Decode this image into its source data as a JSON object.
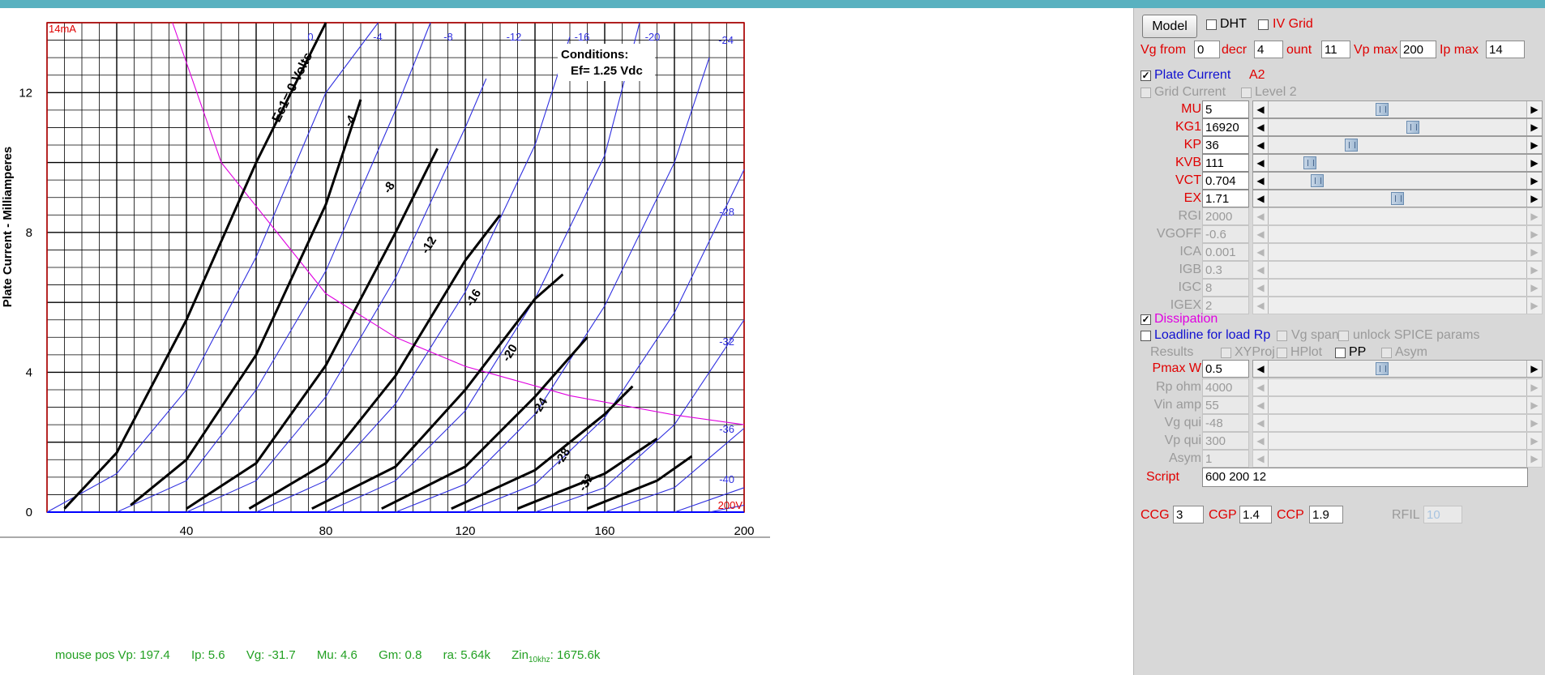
{
  "chart_data": {
    "type": "line",
    "title": "",
    "ylabel": "Plate Current - Milliamperes",
    "xlabel": "",
    "xlim": [
      0,
      200
    ],
    "ylim": [
      0,
      14
    ],
    "x_ticks": [
      "40",
      "80",
      "120",
      "160",
      "200"
    ],
    "y_ticks": [
      "0",
      "4",
      "8",
      "12"
    ],
    "y_top_label": "14mA",
    "x_end_label": "200V",
    "conditions_title": "Conditions:",
    "conditions_value": "Ef= 1.25 Vdc",
    "ec1_label": "Ec1= 0 Volts",
    "curve_labels": [
      "-4",
      "-8",
      "-12",
      "-16",
      "-20",
      "-24",
      "-28",
      "-32"
    ],
    "model_grid_labels": [
      "0",
      "-4",
      "-8",
      "-12",
      "-16",
      "-20",
      "-24",
      "-28",
      "-32",
      "-36",
      "-40"
    ],
    "grid": true,
    "series": [
      {
        "name": "0",
        "color": "#000000",
        "x": [
          5,
          20,
          40,
          60,
          80
        ],
        "y": [
          0.1,
          1.7,
          5.5,
          10.0,
          14.0
        ]
      },
      {
        "name": "-4",
        "color": "#000000",
        "x": [
          24,
          40,
          60,
          80,
          90
        ],
        "y": [
          0.2,
          1.5,
          4.5,
          8.8,
          11.8
        ]
      },
      {
        "name": "-8",
        "color": "#000000",
        "x": [
          40,
          60,
          80,
          100,
          112
        ],
        "y": [
          0.1,
          1.4,
          4.2,
          8.0,
          10.4
        ]
      },
      {
        "name": "-12",
        "color": "#000000",
        "x": [
          58,
          80,
          100,
          120,
          130
        ],
        "y": [
          0.1,
          1.4,
          3.9,
          7.2,
          8.5
        ]
      },
      {
        "name": "-16",
        "color": "#000000",
        "x": [
          76,
          100,
          120,
          140,
          148
        ],
        "y": [
          0.1,
          1.3,
          3.5,
          6.1,
          6.8
        ]
      },
      {
        "name": "-20",
        "color": "#000000",
        "x": [
          96,
          120,
          140,
          155
        ],
        "y": [
          0.1,
          1.3,
          3.3,
          5.0
        ]
      },
      {
        "name": "-24",
        "color": "#000000",
        "x": [
          116,
          140,
          160,
          168
        ],
        "y": [
          0.1,
          1.2,
          2.8,
          3.6
        ]
      },
      {
        "name": "-28",
        "color": "#000000",
        "x": [
          135,
          160,
          175
        ],
        "y": [
          0.1,
          1.1,
          2.1
        ]
      },
      {
        "name": "-32",
        "color": "#000000",
        "x": [
          155,
          175,
          185
        ],
        "y": [
          0.1,
          0.9,
          1.6
        ]
      }
    ],
    "model_series": [
      {
        "name": "0",
        "x": [
          0,
          20,
          40,
          60,
          80,
          95
        ],
        "y": [
          0,
          1.1,
          3.5,
          7.3,
          12.0,
          14.0
        ]
      },
      {
        "name": "-4",
        "x": [
          20,
          40,
          60,
          80,
          100,
          110
        ],
        "y": [
          0,
          0.9,
          3.5,
          6.9,
          11.5,
          14.0
        ]
      },
      {
        "name": "-8",
        "x": [
          40,
          60,
          80,
          100,
          120,
          126
        ],
        "y": [
          0,
          0.9,
          3.3,
          6.7,
          11.0,
          12.4
        ]
      },
      {
        "name": "-12",
        "x": [
          60,
          80,
          100,
          120,
          140,
          150
        ],
        "y": [
          0,
          0.9,
          3.1,
          6.3,
          10.5,
          13.6
        ]
      },
      {
        "name": "-16",
        "x": [
          80,
          100,
          120,
          140,
          160,
          170
        ],
        "y": [
          0,
          0.9,
          2.9,
          6.1,
          10.2,
          14.0
        ]
      },
      {
        "name": "-20",
        "x": [
          100,
          120,
          140,
          160,
          180,
          190
        ],
        "y": [
          0,
          0.8,
          2.8,
          5.9,
          10.0,
          13.0
        ]
      },
      {
        "name": "-24",
        "x": [
          120,
          140,
          160,
          180,
          200
        ],
        "y": [
          0,
          0.8,
          2.7,
          5.7,
          9.8
        ]
      },
      {
        "name": "-28",
        "x": [
          140,
          160,
          180,
          200
        ],
        "y": [
          0,
          0.7,
          2.5,
          5.5
        ]
      },
      {
        "name": "-32",
        "x": [
          160,
          180,
          200
        ],
        "y": [
          0,
          0.7,
          2.4
        ]
      },
      {
        "name": "-36",
        "x": [
          180,
          200
        ],
        "y": [
          0,
          0.7
        ]
      },
      {
        "name": "-40",
        "x": [
          190,
          200
        ],
        "y": [
          0,
          0.2
        ]
      }
    ],
    "dissipation": {
      "x": [
        36,
        50,
        80,
        100,
        120,
        150,
        180,
        200
      ],
      "y": [
        14.0,
        10.0,
        6.25,
        5.0,
        4.17,
        3.33,
        2.78,
        2.5
      ]
    }
  },
  "status_bar": {
    "vp": "mouse pos Vp: 197.4",
    "ip": "Ip: 5.6",
    "vg": "Vg: -31.7",
    "mu": "Mu: 4.6",
    "gm": "Gm: 0.8",
    "ra": "ra: 5.64k",
    "zin_label": "Zin",
    "zin_sub": "10khz",
    "zin_value": ": 1675.6k"
  },
  "panel": {
    "model_button": "Model",
    "dht_label": "DHT",
    "ivgrid_label": "IV Grid",
    "vg_from_label": "Vg from",
    "vg_from_value": "0",
    "decr_label": "decr",
    "decr_value": "4",
    "count_label": "ount",
    "count_value": "11",
    "vp_max_label": "Vp max",
    "vp_max_value": "200",
    "ip_max_label": "Ip max",
    "ip_max_value": "14",
    "plate_current_label": "Plate Current",
    "a2_label": "A2",
    "grid_current_label": "Grid Current",
    "level2_label": "Level 2",
    "params": [
      {
        "label": "MU",
        "value": "5",
        "level": 0.44
      },
      {
        "label": "KG1",
        "value": "16920",
        "level": 0.56
      },
      {
        "label": "KP",
        "value": "36",
        "level": 0.32
      },
      {
        "label": "KVB",
        "value": "111",
        "level": 0.16
      },
      {
        "label": "VCT",
        "value": "0.704",
        "level": 0.19
      },
      {
        "label": "EX",
        "value": "1.71",
        "level": 0.5
      }
    ],
    "disabled_params": [
      {
        "label": "RGI",
        "value": "2000"
      },
      {
        "label": "VGOFF",
        "value": "-0.6"
      },
      {
        "label": "ICA",
        "value": "0.001"
      },
      {
        "label": "IGB",
        "value": "0.3"
      },
      {
        "label": "IGC",
        "value": "8"
      },
      {
        "label": "IGEX",
        "value": "2"
      }
    ],
    "dissipation_label": "Dissipation",
    "loadline_label": "Loadline for load Rp",
    "vg_span_label": "Vg span",
    "unlock_label": "unlock SPICE params",
    "results_label": "Results",
    "xyproj_label": "XYProj",
    "hplot_label": "HPlot",
    "pp_label": "PP",
    "asym_label": "Asym",
    "pmax_label": "Pmax W",
    "pmax_value": "0.5",
    "pmax_level": 0.44,
    "load_params": [
      {
        "label": "Rp ohm",
        "value": "4000"
      },
      {
        "label": "Vin amp",
        "value": "55"
      },
      {
        "label": "Vg qui",
        "value": "-48"
      },
      {
        "label": "Vp qui",
        "value": "300"
      },
      {
        "label": "Asym",
        "value": "1"
      }
    ],
    "script_label": "Script",
    "script_value": "600 200 12",
    "ccg_label": "CCG",
    "ccg_value": "3",
    "cgp_label": "CGP",
    "cgp_value": "1.4",
    "ccp_label": "CCP",
    "ccp_value": "1.9",
    "rfil_label": "RFIL",
    "rfil_value": "10"
  }
}
